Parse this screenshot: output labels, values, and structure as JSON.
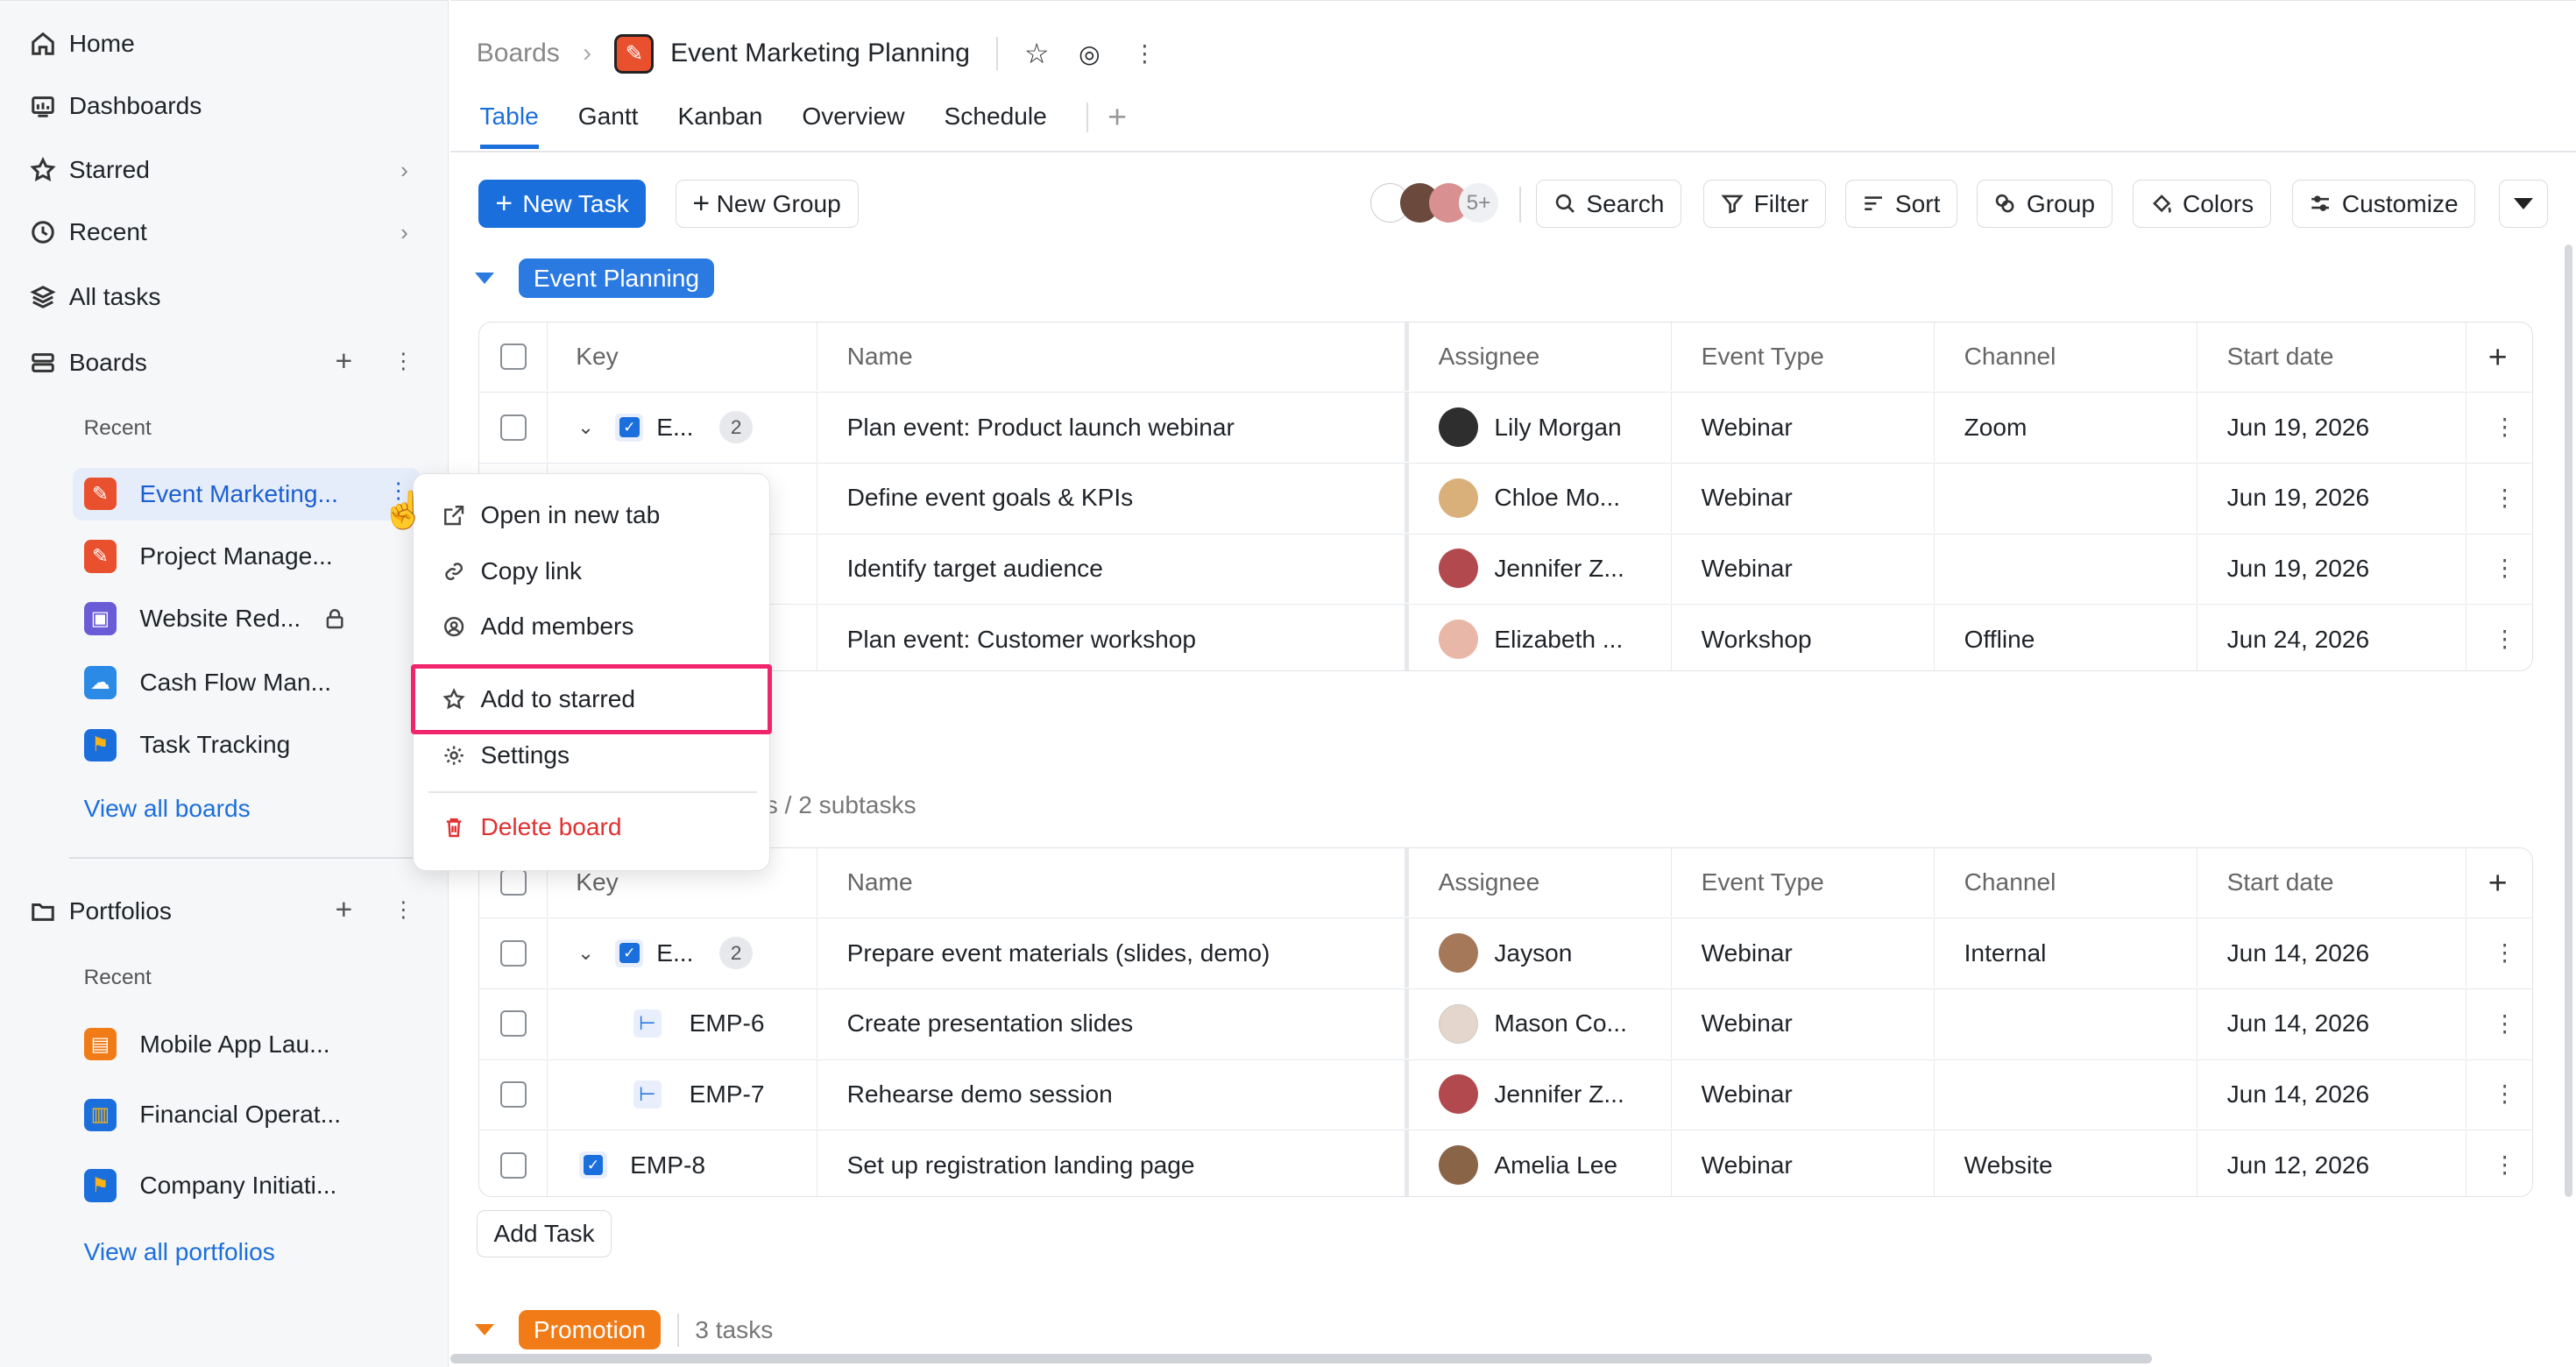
{
  "sidebar": {
    "nav": [
      {
        "label": "Home",
        "icon": "home-icon"
      },
      {
        "label": "Dashboards",
        "icon": "dashboard-icon"
      },
      {
        "label": "Starred",
        "icon": "star-icon"
      },
      {
        "label": "Recent",
        "icon": "clock-icon"
      },
      {
        "label": "All tasks",
        "icon": "layers-icon"
      }
    ],
    "boards_label": "Boards",
    "boards_recent_label": "Recent",
    "boards": [
      {
        "label": "Event Marketing...",
        "color": "#e8502e"
      },
      {
        "label": "Project Manage...",
        "color": "#e8502e"
      },
      {
        "label": "Website Red...",
        "color": "#6a5bd6"
      },
      {
        "label": "Cash Flow Man...",
        "color": "#2b8ae6"
      },
      {
        "label": "Task Tracking",
        "color": "#1b6fdc"
      }
    ],
    "view_all_boards": "View all boards",
    "portfolios_label": "Portfolios",
    "portfolios_recent_label": "Recent",
    "portfolios": [
      {
        "label": "Mobile App Lau...",
        "color": "#f07b17"
      },
      {
        "label": "Financial Operat...",
        "color": "#1b6fdc"
      },
      {
        "label": "Company Initiati...",
        "color": "#1b6fdc"
      }
    ],
    "view_all_portfolios": "View all portfolios"
  },
  "header": {
    "breadcrumb_root": "Boards",
    "board_title": "Event Marketing Planning",
    "tabs": [
      "Table",
      "Gantt",
      "Kanban",
      "Overview",
      "Schedule"
    ],
    "active_tab": "Table"
  },
  "toolbar": {
    "new_task": "New Task",
    "new_group": "New Group",
    "members_more": "5+",
    "search": "Search",
    "filter": "Filter",
    "sort": "Sort",
    "group": "Group",
    "colors": "Colors",
    "customize": "Customize"
  },
  "columns": [
    "Key",
    "Name",
    "Assignee",
    "Event Type",
    "Channel",
    "Start date"
  ],
  "groups": [
    {
      "name": "Event Planning",
      "color": "#2a7ae2",
      "rows": [
        {
          "key": "E...",
          "subcount": "2",
          "name": "Plan event: Product launch webinar",
          "assignee": "Lily Morgan",
          "event_type": "Webinar",
          "channel": "Zoom",
          "start": "Jun 19, 2026"
        },
        {
          "key": "",
          "subcount": "",
          "name": "Define event goals & KPIs",
          "assignee": "Chloe Mo...",
          "event_type": "Webinar",
          "channel": "",
          "start": "Jun 19, 2026"
        },
        {
          "key": "",
          "subcount": "",
          "name": "Identify target audience",
          "assignee": "Jennifer Z...",
          "event_type": "Webinar",
          "channel": "",
          "start": "Jun 19, 2026"
        },
        {
          "key": "",
          "subcount": "",
          "name": "Plan event: Customer workshop",
          "assignee": "Elizabeth ...",
          "event_type": "Workshop",
          "channel": "Offline",
          "start": "Jun 24, 2026"
        }
      ]
    },
    {
      "name": "",
      "summary": "s / 2 subtasks",
      "rows": [
        {
          "key": "E...",
          "subcount": "2",
          "name": "Prepare event materials (slides, demo)",
          "assignee": "Jayson",
          "event_type": "Webinar",
          "channel": "Internal",
          "start": "Jun 14, 2026"
        },
        {
          "key": "EMP-6",
          "subcount": "",
          "name": "Create presentation slides",
          "assignee": "Mason Co...",
          "event_type": "Webinar",
          "channel": "",
          "start": "Jun 14, 2026"
        },
        {
          "key": "EMP-7",
          "subcount": "",
          "name": "Rehearse demo session",
          "assignee": "Jennifer Z...",
          "event_type": "Webinar",
          "channel": "",
          "start": "Jun 14, 2026"
        },
        {
          "key": "EMP-8",
          "subcount": "",
          "name": "Set up registration landing page",
          "assignee": "Amelia Lee",
          "event_type": "Webinar",
          "channel": "Website",
          "start": "Jun 12, 2026"
        }
      ],
      "add_task": "Add Task"
    },
    {
      "name": "Promotion",
      "color": "#f07b17",
      "summary": "3 tasks"
    }
  ],
  "context_menu": {
    "items": [
      "Open in new tab",
      "Copy link",
      "Add members",
      "Add to starred",
      "Settings",
      "Delete board"
    ],
    "highlighted": "Add to starred"
  }
}
